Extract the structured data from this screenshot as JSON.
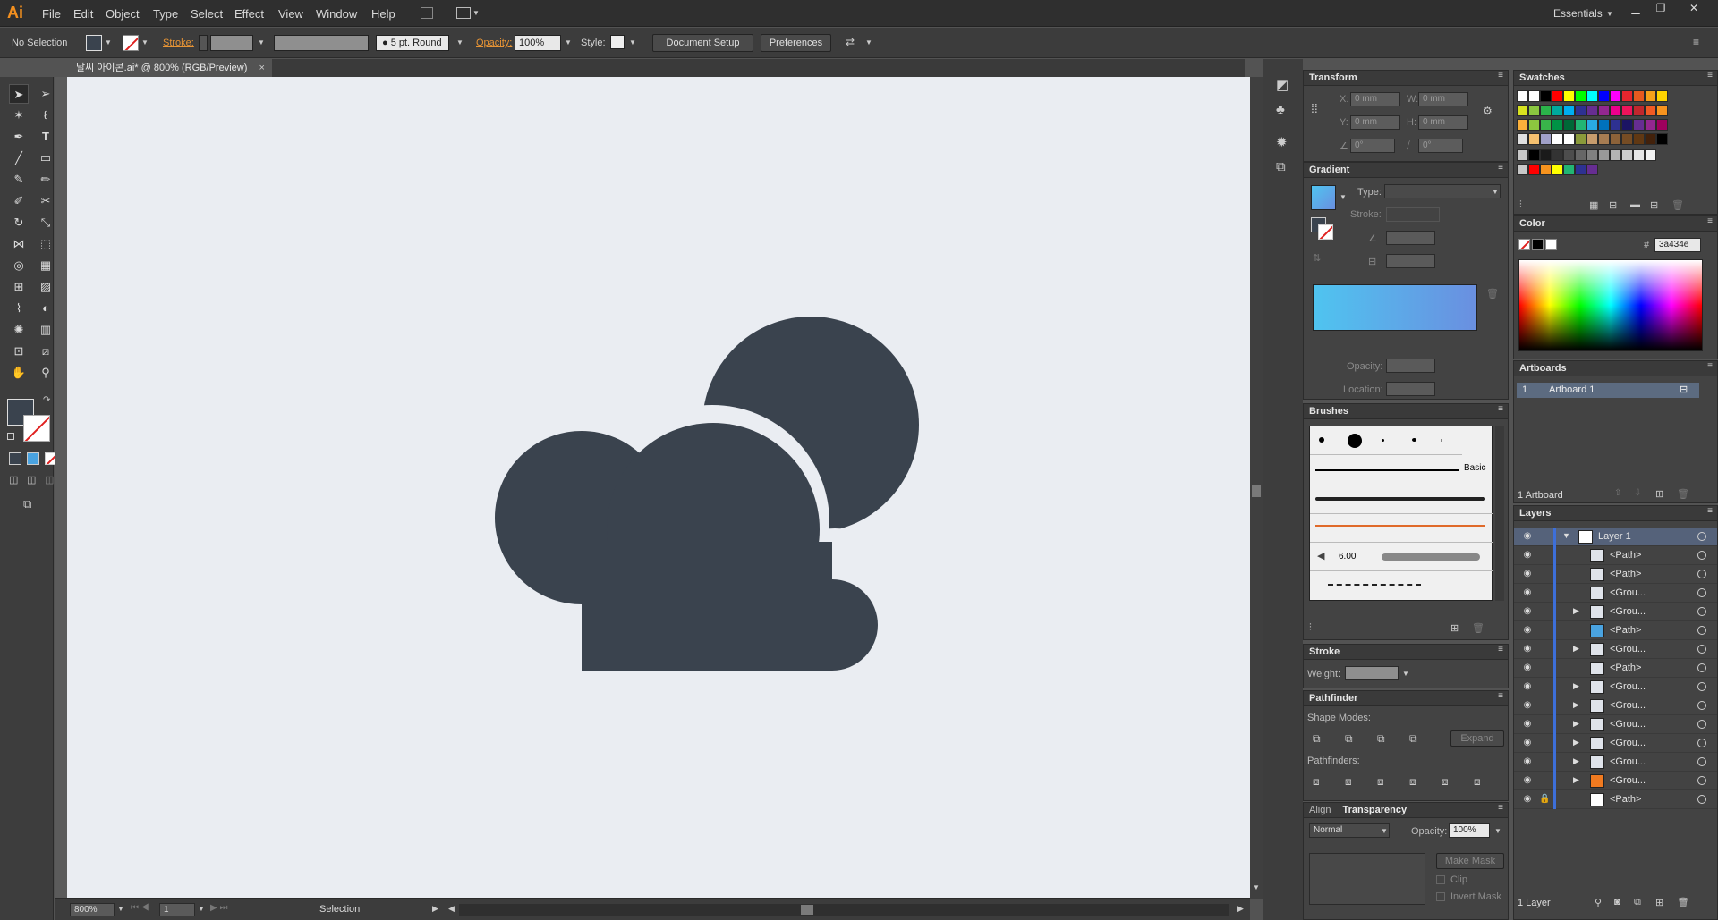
{
  "app": {
    "logo": "Ai",
    "workspace": "Essentials"
  },
  "menu": [
    "File",
    "Edit",
    "Object",
    "Type",
    "Select",
    "Effect",
    "View",
    "Window",
    "Help"
  ],
  "control": {
    "selection": "No Selection",
    "stroke_label": "Stroke:",
    "brush": "5 pt. Round",
    "opacity_label": "Opacity:",
    "opacity_value": "100%",
    "style_label": "Style:",
    "document_setup": "Document Setup",
    "preferences": "Preferences"
  },
  "document": {
    "tab_title": "날씨 아이콘.ai* @ 800% (RGB/Preview)",
    "close": "×"
  },
  "status": {
    "zoom": "800%",
    "page": "1",
    "mode": "Selection"
  },
  "transform": {
    "title": "Transform",
    "x_label": "X:",
    "x": "0 mm",
    "w_label": "W:",
    "w": "0 mm",
    "y_label": "Y:",
    "y": "0 mm",
    "h_label": "H:",
    "h": "0 mm",
    "angle": "0°",
    "shear": "0°"
  },
  "gradient": {
    "title": "Gradient",
    "type_label": "Type:",
    "stroke_label": "Stroke:",
    "opacity_label": "Opacity:",
    "location_label": "Location:",
    "start_color": "#4fc4f0",
    "end_color": "#6a8fe0"
  },
  "brushes": {
    "title": "Brushes",
    "basic": "Basic",
    "size": "6.00"
  },
  "stroke": {
    "title": "Stroke",
    "weight_label": "Weight:"
  },
  "pathfinder": {
    "title": "Pathfinder",
    "shape_modes": "Shape Modes:",
    "pathfinders": "Pathfinders:",
    "expand": "Expand"
  },
  "transparency": {
    "tab_align": "Align",
    "title": "Transparency",
    "blend": "Normal",
    "opacity_label": "Opacity:",
    "opacity": "100%",
    "make_mask": "Make Mask",
    "clip": "Clip",
    "invert": "Invert Mask"
  },
  "swatches": {
    "title": "Swatches"
  },
  "color": {
    "title": "Color",
    "hash": "#",
    "hex": "3a434e"
  },
  "artboards": {
    "title": "Artboards",
    "index": "1",
    "name": "Artboard 1",
    "count": "1 Artboard"
  },
  "layers": {
    "title": "Layers",
    "footer": "1 Layer",
    "rows": [
      {
        "name": "Layer 1",
        "expand": "▼"
      },
      {
        "name": "<Path>",
        "expand": ""
      },
      {
        "name": "<Path>",
        "expand": ""
      },
      {
        "name": "<Grou...",
        "expand": ""
      },
      {
        "name": "<Grou...",
        "expand": "▶"
      },
      {
        "name": "<Path>",
        "expand": ""
      },
      {
        "name": "<Grou...",
        "expand": "▶"
      },
      {
        "name": "<Path>",
        "expand": ""
      },
      {
        "name": "<Grou...",
        "expand": "▶"
      },
      {
        "name": "<Grou...",
        "expand": "▶"
      },
      {
        "name": "<Grou...",
        "expand": "▶"
      },
      {
        "name": "<Grou...",
        "expand": "▶"
      },
      {
        "name": "<Grou...",
        "expand": "▶"
      },
      {
        "name": "<Grou...",
        "expand": "▶"
      },
      {
        "name": "<Path>",
        "expand": ""
      }
    ]
  },
  "artwork": {
    "fill_color": "#3a434e",
    "background": "#eaedf2"
  }
}
